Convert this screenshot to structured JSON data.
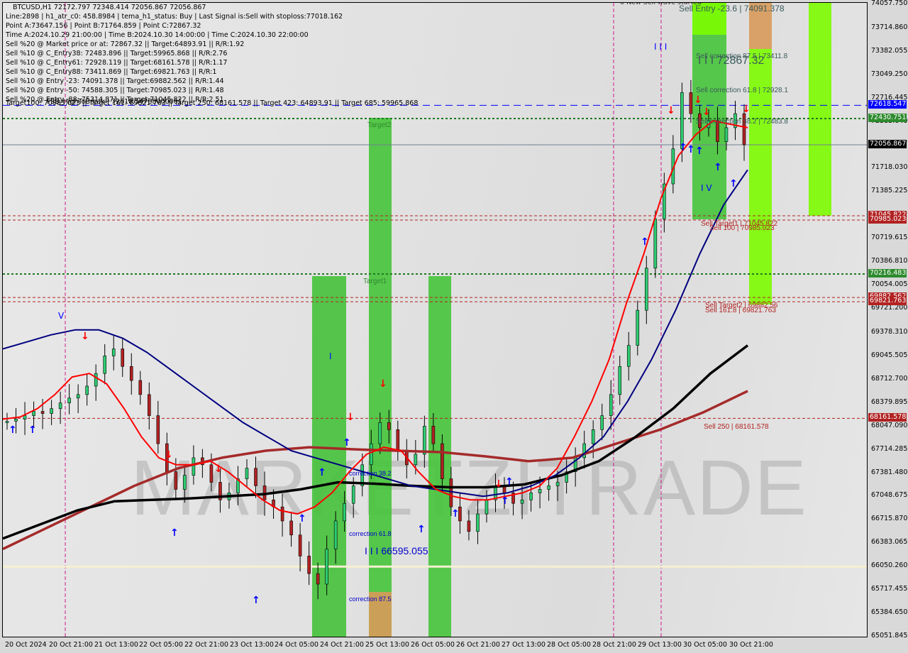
{
  "header": {
    "symbol_line": "BTCUSD,H1  72172.797 72348.414 72056.867 72056.867",
    "lines": [
      "Line:2898 | h1_atr_c0: 458.8984 | tema_h1_status: Buy | Last Signal is:Sell with stoploss:77018.162",
      "Point A:73647.156 | Point B:71764.859 | Point C:72867.32",
      "Time A:2024.10.29 21:00:00 | Time B:2024.10.30 14:00:00 | Time C:2024.10.30 22:00:00",
      "Sell %20 @ Market price or at: 72867.32 || Target:64893.91 || R/R:1.92",
      "Sell %10 @ C_Entry38: 72483.896 || Target:59965.868 || R/R:2.76",
      "Sell %10 @ C_Entry61: 72928.119 || Target:68161.578 || R/R:1.17",
      "Sell %10 @ C_Entry88: 73411.869 || Target:69821.763 || R/R:1",
      "Sell %10 @ Entry -23: 74091.378 || Target:69882.562 || R/R:1.44",
      "Sell %20 @ Entry -50: 74588.305 || Target:70985.023 || R/R:1.48",
      "Sell %20 @ Entry -88: 75314.871 || Target:71045.822 || R/R:2.51"
    ],
    "targets_line": "Target100: 70985.023 || Target 161: 69821.763 || Target 250: 68161.578 || Target 423: 64893.91 || Target 685: 59965.868",
    "overlay_line": "FSB_HighToBreak | 72618.54788000001",
    "top_cut_label": "0 New Sell wave started"
  },
  "chart_data": {
    "type": "candlestick",
    "title": "BTCUSD,H1",
    "ylim": [
      65051.845,
      74057.75
    ],
    "y_ticks": [
      "74057.750",
      "73714.860",
      "73382.055",
      "73049.250",
      "72716.445",
      "72383.640",
      "72056.867",
      "71718.030",
      "71385.225",
      "71045.822",
      "70719.615",
      "70386.810",
      "70054.005",
      "69721.200",
      "69378.310",
      "69045.505",
      "68712.700",
      "68379.895",
      "68047.090",
      "67714.285",
      "67381.480",
      "67048.675",
      "66715.870",
      "66383.065",
      "66050.260",
      "65717.455",
      "65384.650",
      "65051.845"
    ],
    "x_ticks": [
      "20 Oct 2024",
      "20 Oct 21:00",
      "21 Oct 13:00",
      "22 Oct 05:00",
      "22 Oct 21:00",
      "23 Oct 13:00",
      "24 Oct 05:00",
      "24 Oct 21:00",
      "25 Oct 13:00",
      "26 Oct 05:00",
      "26 Oct 21:00",
      "27 Oct 13:00",
      "28 Oct 05:00",
      "28 Oct 21:00",
      "29 Oct 13:00",
      "30 Oct 05:00",
      "30 Oct 21:00"
    ],
    "last_ohlc": {
      "open": 72172.797,
      "high": 72348.414,
      "low": 72056.867,
      "close": 72056.867
    },
    "price_tags": [
      {
        "label": "72618.547",
        "value": 72618.547,
        "color": "#0000ff"
      },
      {
        "label": "72430.751",
        "value": 72430.751,
        "color": "#2e8b2e"
      },
      {
        "label": "72056.867",
        "value": 72056.867,
        "color": "#000000"
      },
      {
        "label": "71045.822",
        "value": 71045.822,
        "color": "#b22222"
      },
      {
        "label": "70985.023",
        "value": 70985.023,
        "color": "#b22222"
      },
      {
        "label": "70216.483",
        "value": 70216.483,
        "color": "#2e8b2e"
      },
      {
        "label": "69882.562",
        "value": 69882.562,
        "color": "#b22222"
      },
      {
        "label": "69821.763",
        "value": 69821.763,
        "color": "#b22222"
      },
      {
        "label": "68161.578",
        "value": 68161.578,
        "color": "#b22222"
      }
    ],
    "level_labels": [
      {
        "text": "Sell Entry -23.6 | 74091.378",
        "value": 74091.378,
        "color": "#3a5a5a"
      },
      {
        "text": "Sell correction 87.5 | 73411.8",
        "value": 73411.8,
        "color": "#3a5a5a"
      },
      {
        "text": "I I I 72867.32",
        "value": 72867.32,
        "color": "#3a5a5a"
      },
      {
        "text": "Sell correction 61.8 | 72928.1",
        "value": 72928.1,
        "color": "#3a5a5a"
      },
      {
        "text": "Sell correction 38.2 | 72483.8",
        "value": 72483.8,
        "color": "#3a5a5a"
      },
      {
        "text": "Sell Target1 | 71045.822",
        "value": 71045.822,
        "color": "#b22222"
      },
      {
        "text": "Sell 100 | 70985.023",
        "value": 70985.023,
        "color": "#b22222"
      },
      {
        "text": "Sell Target2 | 69882.56",
        "value": 69882.56,
        "color": "#b22222"
      },
      {
        "text": "Sell 161.8 | 69821.763",
        "value": 69821.763,
        "color": "#b22222"
      },
      {
        "text": "Sell 250 | 68161.578",
        "value": 68161.578,
        "color": "#b22222"
      },
      {
        "text": "Target2",
        "value": 72430.751,
        "color": "#2e8b2e"
      },
      {
        "text": "Target1",
        "value": 70216.483,
        "color": "#2e8b2e"
      },
      {
        "text": "correction 38.2",
        "value": 67381.48,
        "color": "#0000cc"
      },
      {
        "text": "correction 61.8",
        "value": 66715.87,
        "color": "#0000cc"
      },
      {
        "text": "I I I 66595.055",
        "value": 66595.055,
        "color": "#0000cc"
      },
      {
        "text": "correction 87.5",
        "value": 65717.455,
        "color": "#0000cc"
      }
    ],
    "wave_marks": [
      "V",
      "I",
      "I I I",
      "I V"
    ],
    "watermark": "MARKETZITRADE",
    "series": [
      {
        "name": "close",
        "values": [
          68120,
          68150,
          68200,
          68260,
          68230,
          68300,
          68380,
          68450,
          68500,
          68620,
          68800,
          69050,
          69150,
          68900,
          68700,
          68500,
          68200,
          67800,
          67400,
          67150,
          67350,
          67600,
          67500,
          67250,
          67000,
          67100,
          67300,
          67450,
          67200,
          67000,
          66900,
          66700,
          66500,
          66200,
          65950,
          65800,
          66300,
          66700,
          66950,
          67200,
          67500,
          67800,
          68100,
          68000,
          67700,
          67500,
          67650,
          68050,
          67800,
          67300,
          66900,
          66700,
          66550,
          66800,
          67000,
          67200,
          67100,
          66950,
          67000,
          67100,
          67150,
          67200,
          67250,
          67400,
          67600,
          67800,
          68000,
          68200,
          68500,
          68900,
          69200,
          69700,
          70300,
          71000,
          71500,
          72000,
          72800,
          72500,
          72300,
          72400,
          72100,
          72300,
          72500,
          72056.867
        ]
      },
      {
        "name": "ema_red",
        "values": [
          68150,
          68180,
          68300,
          68500,
          68750,
          68800,
          68650,
          68300,
          67900,
          67600,
          67500,
          67500,
          67550,
          67400,
          67200,
          67000,
          66850,
          66800,
          66900,
          67100,
          67400,
          67650,
          67750,
          67700,
          67400,
          67150,
          67050,
          67000,
          67000,
          67050,
          67100,
          67200,
          67450,
          67900,
          68400,
          69000,
          69800,
          70500,
          71300,
          71900,
          72200,
          72400,
          72350,
          72300
        ]
      },
      {
        "name": "ma_blue",
        "values": [
          69150,
          69250,
          69350,
          69420,
          69420,
          69300,
          69100,
          68850,
          68600,
          68350,
          68100,
          67900,
          67700,
          67600,
          67500,
          67400,
          67300,
          67200,
          67150,
          67100,
          67050,
          67100,
          67200,
          67350,
          67600,
          67900,
          68400,
          69000,
          69700,
          70500,
          71200,
          71700
        ]
      },
      {
        "name": "ma_black",
        "values": [
          66450,
          66650,
          66850,
          66980,
          67000,
          67020,
          67050,
          67080,
          67150,
          67250,
          67230,
          67200,
          67180,
          67180,
          67220,
          67350,
          67550,
          67900,
          68300,
          68800,
          69200
        ]
      },
      {
        "name": "ma_brown",
        "values": [
          66300,
          66600,
          66900,
          67200,
          67450,
          67600,
          67700,
          67750,
          67720,
          67700,
          67680,
          67620,
          67550,
          67600,
          67800,
          68000,
          68250,
          68550
        ]
      }
    ]
  }
}
